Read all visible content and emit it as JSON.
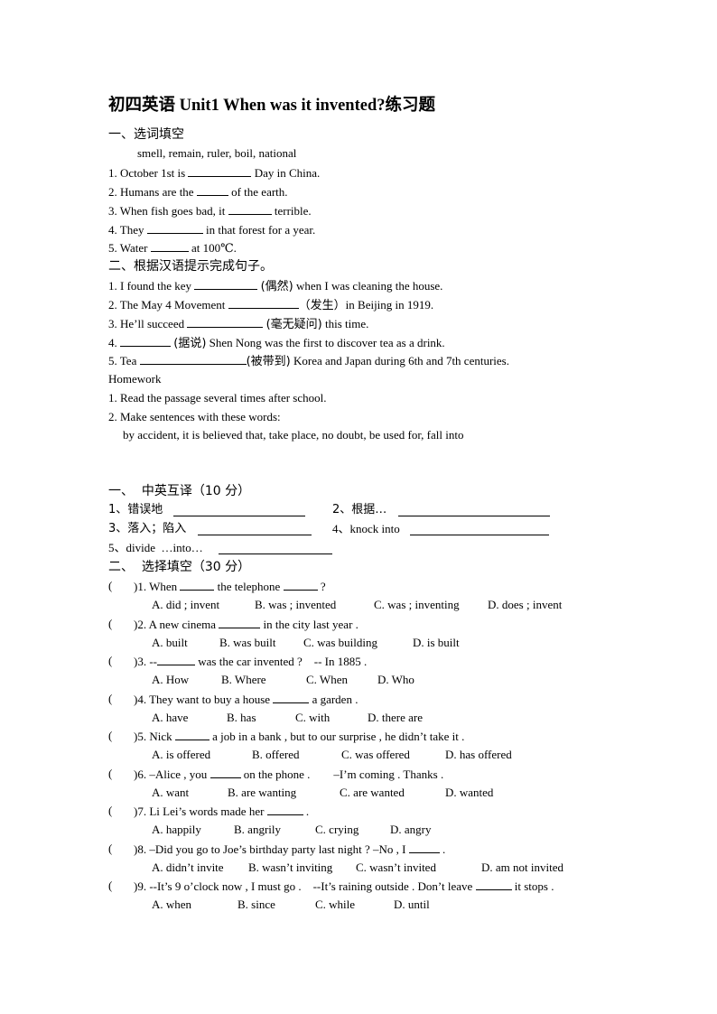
{
  "title": "初四英语 Unit1 When was it invented?练习题",
  "part1": {
    "heading": "一、选词填空",
    "word_bank": "smell, remain, ruler, boil, national",
    "items": [
      {
        "pre": "1. October 1st is ",
        "post": " Day in China."
      },
      {
        "pre": "2. Humans are the ",
        "post": " of the earth."
      },
      {
        "pre": "3. When fish goes bad, it ",
        "post": " terrible."
      },
      {
        "pre": "4. They ",
        "post": " in that forest for a year."
      },
      {
        "pre": "5. Water ",
        "post": " at 100℃."
      }
    ]
  },
  "part2": {
    "heading": "二、根据汉语提示完成句子。",
    "items": [
      {
        "pre": "1. I found the key ",
        "hint": "(偶然)",
        "post": " when I was cleaning the house."
      },
      {
        "pre": "2. The May 4 Movement ",
        "hint": "（发生）",
        "post": "in Beijing in 1919."
      },
      {
        "pre": "3. He’ll succeed ",
        "hint": "(毫无疑问)",
        "post": " this time."
      },
      {
        "pre": "4. ",
        "hint": "(据说)",
        "post": " Shen Nong was the first to discover tea as a drink."
      },
      {
        "pre": "5. Tea ",
        "hint": "(被带到)",
        "post": " Korea and Japan during 6th and 7th centuries."
      }
    ]
  },
  "homework": {
    "heading": "Homework",
    "items": [
      "1. Read the passage several times after school.",
      "2. Make sentences with these words:"
    ],
    "phrases": "by accident, it is believed that, take place, no doubt, be used for, fall into"
  },
  "translate": {
    "heading": "一、  中英互译（10 分）",
    "items": [
      "1、错误地",
      "2、根据…",
      "3、落入；陷入",
      "4、knock into",
      "5、divide  …into…"
    ]
  },
  "choice": {
    "heading": "二、  选择填空（30 分）",
    "paren": "(",
    "questions": [
      {
        "num": ")1. ",
        "stem": [
          "When ",
          " the telephone ",
          " ?"
        ],
        "options": [
          "A. did ; invent",
          "B. was ; invented",
          "C. was ; inventing",
          "D. does ; invent"
        ]
      },
      {
        "num": ")2. ",
        "stem": [
          "A new cinema ",
          " in the city last year ."
        ],
        "options": [
          "A. built",
          "B. was built",
          "C. was building",
          "D. is built"
        ]
      },
      {
        "num": ")3. ",
        "stem": [
          "--",
          " was the car invented ?    -- In 1885 ."
        ],
        "options": [
          "A. How",
          "B. Where",
          "C. When",
          "D. Who"
        ]
      },
      {
        "num": ")4. ",
        "stem": [
          "They want to buy a house ",
          " a garden ."
        ],
        "options": [
          "A. have",
          "B. has",
          "C. with",
          "D. there are"
        ]
      },
      {
        "num": ")5. ",
        "stem": [
          "Nick ",
          " a job in a bank , but to our surprise , he didn’t take it ."
        ],
        "options": [
          "A. is offered",
          "B. offered",
          "C. was offered",
          "D. has offered"
        ]
      },
      {
        "num": ")6. ",
        "stem": [
          "–Alice , you ",
          " on the phone .        –I’m coming . Thanks ."
        ],
        "options": [
          "A. want",
          "B. are wanting",
          "C. are wanted",
          "D. wanted"
        ]
      },
      {
        "num": ")7. ",
        "stem": [
          "Li Lei’s words made her ",
          " ."
        ],
        "options": [
          "A. happily",
          "B. angrily",
          "C. crying",
          "D. angry"
        ]
      },
      {
        "num": ")8. ",
        "stem": [
          "–Did you go to Joe’s birthday party last night ? –No , I ",
          " ."
        ],
        "options": [
          "A. didn’t invite",
          "B. wasn’t inviting",
          "C. wasn’t invited",
          "D. am not invited"
        ]
      },
      {
        "num": ")9. ",
        "stem": [
          "--It’s 9 o’clock now , I must go .    --It’s raining outside . Don’t leave ",
          " it stops ."
        ],
        "options": [
          "A. when",
          "B. since",
          "C. while",
          "D. until"
        ]
      }
    ]
  }
}
